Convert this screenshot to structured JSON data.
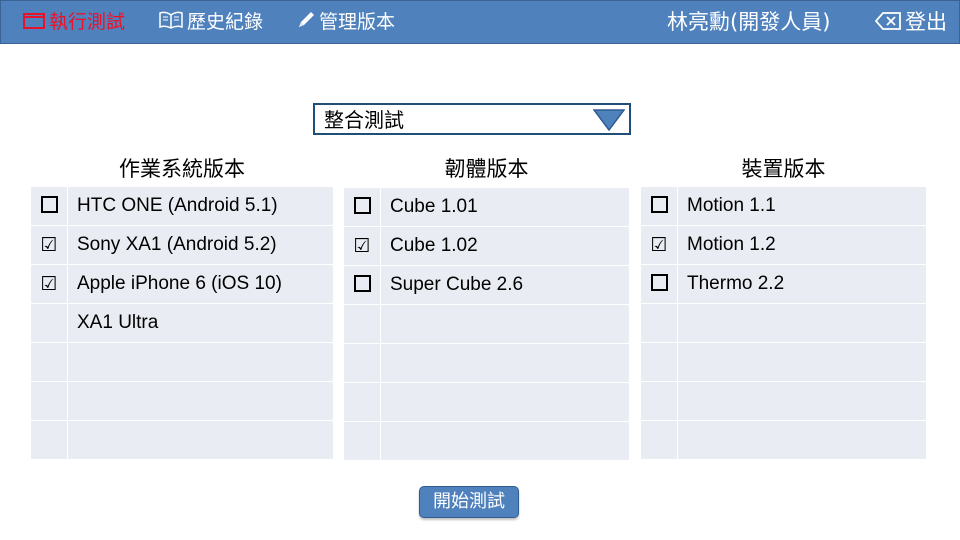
{
  "nav": {
    "run_test": "執行測試",
    "history": "歷史紀錄",
    "manage_versions": "管理版本",
    "user": "林亮勳(開發人員)",
    "logout": "登出"
  },
  "test_type": {
    "selected": "整合測試"
  },
  "panels": {
    "os": {
      "title": "作業系統版本",
      "rows": [
        {
          "label": "HTC ONE (Android 5.1)",
          "checked": false
        },
        {
          "label": "Sony XA1 (Android 5.2)",
          "checked": true
        },
        {
          "label": "Apple iPhone 6 (iOS 10)",
          "checked": true
        },
        {
          "label": "XA1 Ultra",
          "checked": null
        },
        {
          "label": "",
          "checked": null
        },
        {
          "label": "",
          "checked": null
        },
        {
          "label": "",
          "checked": null
        }
      ]
    },
    "firmware": {
      "title": "韌體版本",
      "rows": [
        {
          "label": "Cube 1.01",
          "checked": false
        },
        {
          "label": "Cube 1.02",
          "checked": true
        },
        {
          "label": "Super Cube 2.6",
          "checked": false
        },
        {
          "label": "",
          "checked": null
        },
        {
          "label": "",
          "checked": null
        },
        {
          "label": "",
          "checked": null
        },
        {
          "label": "",
          "checked": null
        }
      ]
    },
    "device": {
      "title": "裝置版本",
      "rows": [
        {
          "label": "Motion 1.1",
          "checked": false
        },
        {
          "label": "Motion 1.2",
          "checked": true
        },
        {
          "label": "Thermo 2.2",
          "checked": false
        },
        {
          "label": "",
          "checked": null
        },
        {
          "label": "",
          "checked": null
        },
        {
          "label": "",
          "checked": null
        },
        {
          "label": "",
          "checked": null
        }
      ]
    }
  },
  "start_button": "開始測試",
  "colors": {
    "topbar": "#4f81bd",
    "active_nav": "#e8132b",
    "panel_bg": "#e9ecf2"
  }
}
